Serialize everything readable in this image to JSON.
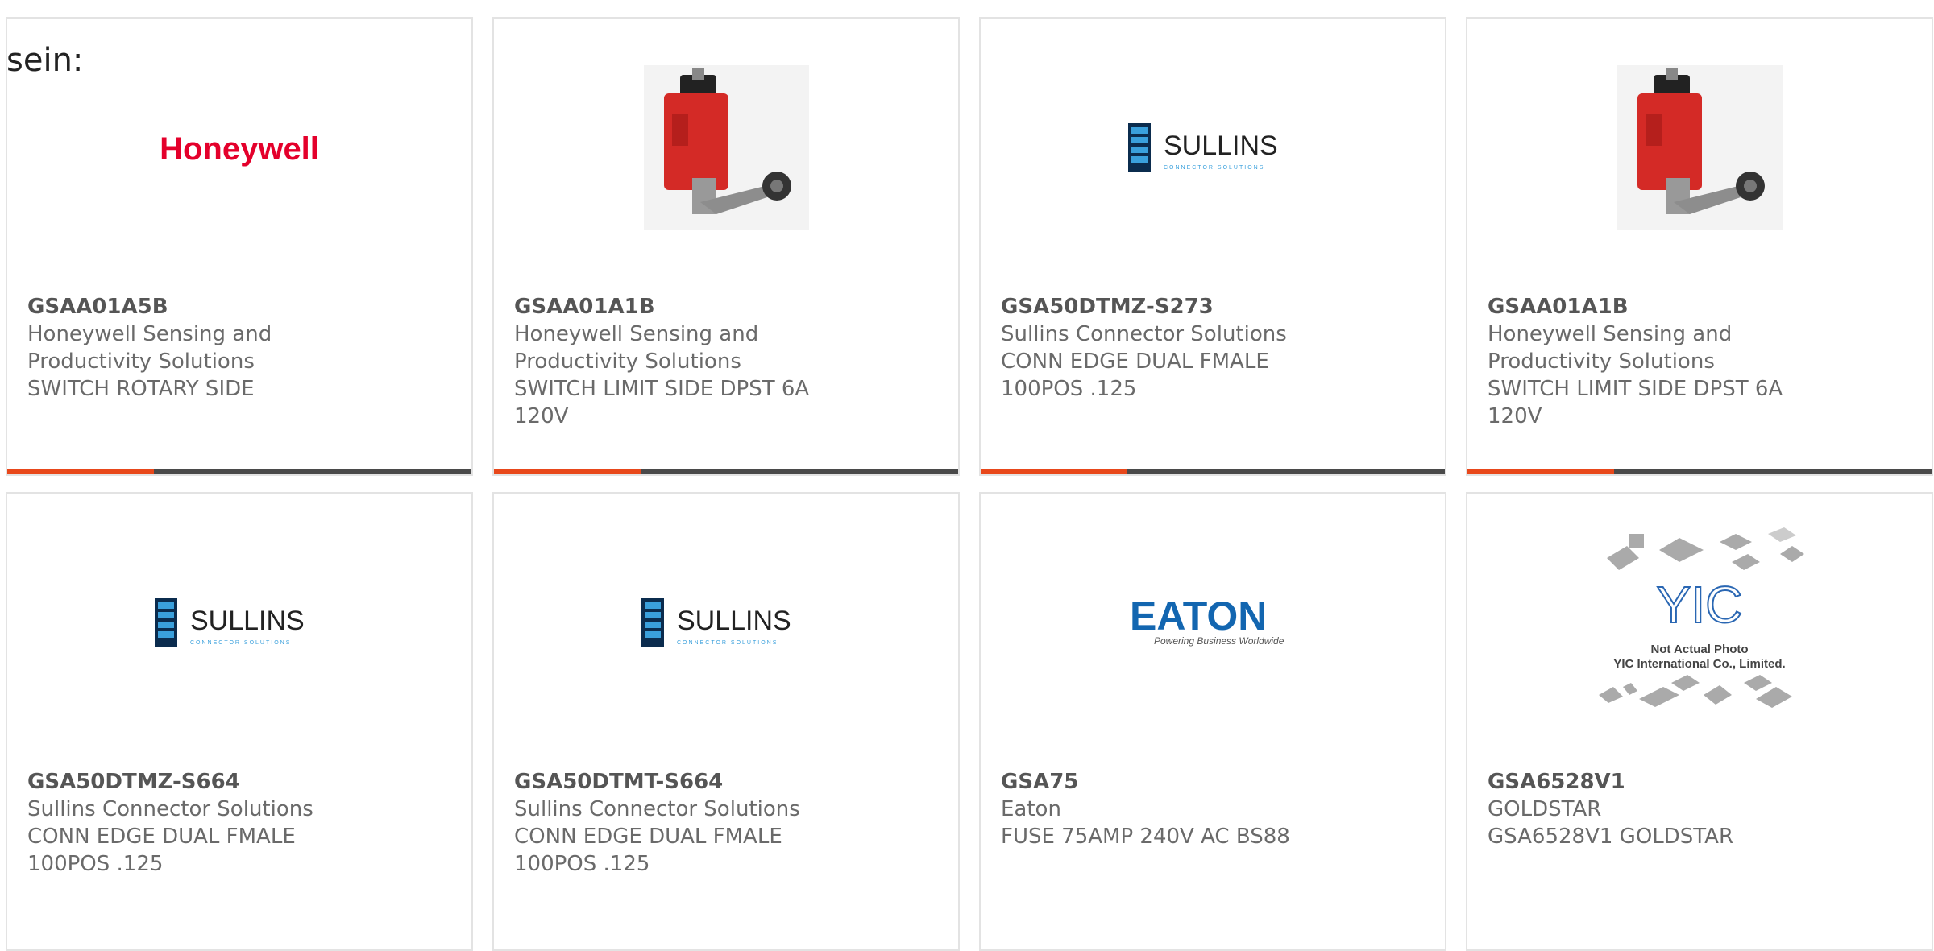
{
  "overlay": {
    "text": "sein:"
  },
  "brand_colors": {
    "accent": "#e8481b",
    "bar_dark": "#4a4a4a",
    "honeywell_red": "#e4002b",
    "sullins_blue": "#1d5f94",
    "eaton_blue": "#1366b0"
  },
  "products": [
    {
      "part": "GSAA01A5B",
      "manufacturer": "Honeywell Sensing and Productivity Solutions",
      "description": "SWITCH ROTARY SIDE",
      "image": "honeywell-logo",
      "logo_text": "Honeywell"
    },
    {
      "part": "GSAA01A1B",
      "manufacturer": "Honeywell Sensing and Productivity Solutions",
      "description": "SWITCH LIMIT SIDE DPST 6A 120V",
      "image": "limit-switch-photo"
    },
    {
      "part": "GSA50DTMZ-S273",
      "manufacturer": "Sullins Connector Solutions",
      "description": "CONN EDGE DUAL FMALE 100POS .125",
      "image": "sullins-logo",
      "logo_text": "SULLINS",
      "logo_sub": "CONNECTOR SOLUTIONS"
    },
    {
      "part": "GSAA01A1B",
      "manufacturer": "Honeywell Sensing and Productivity Solutions",
      "description": "SWITCH LIMIT SIDE DPST 6A 120V",
      "image": "limit-switch-photo"
    },
    {
      "part": "GSA50DTMZ-S664",
      "manufacturer": "Sullins Connector Solutions",
      "description": "CONN EDGE DUAL FMALE 100POS .125",
      "image": "sullins-logo",
      "logo_text": "SULLINS",
      "logo_sub": "CONNECTOR SOLUTIONS"
    },
    {
      "part": "GSA50DTMT-S664",
      "manufacturer": "Sullins Connector Solutions",
      "description": "CONN EDGE DUAL FMALE 100POS .125",
      "image": "sullins-logo",
      "logo_text": "SULLINS",
      "logo_sub": "CONNECTOR SOLUTIONS"
    },
    {
      "part": "GSA75",
      "manufacturer": "Eaton",
      "description": "FUSE 75AMP 240V AC BS88",
      "image": "eaton-logo",
      "logo_text": "EATON",
      "logo_sub": "Powering Business Worldwide"
    },
    {
      "part": "GSA6528V1",
      "manufacturer": "GOLDSTAR",
      "description": "GSA6528V1 GOLDSTAR",
      "image": "not-actual-photo",
      "logo_text": "YIC",
      "note_line1": "Not Actual Photo",
      "note_line2": "YIC International Co., Limited."
    }
  ]
}
